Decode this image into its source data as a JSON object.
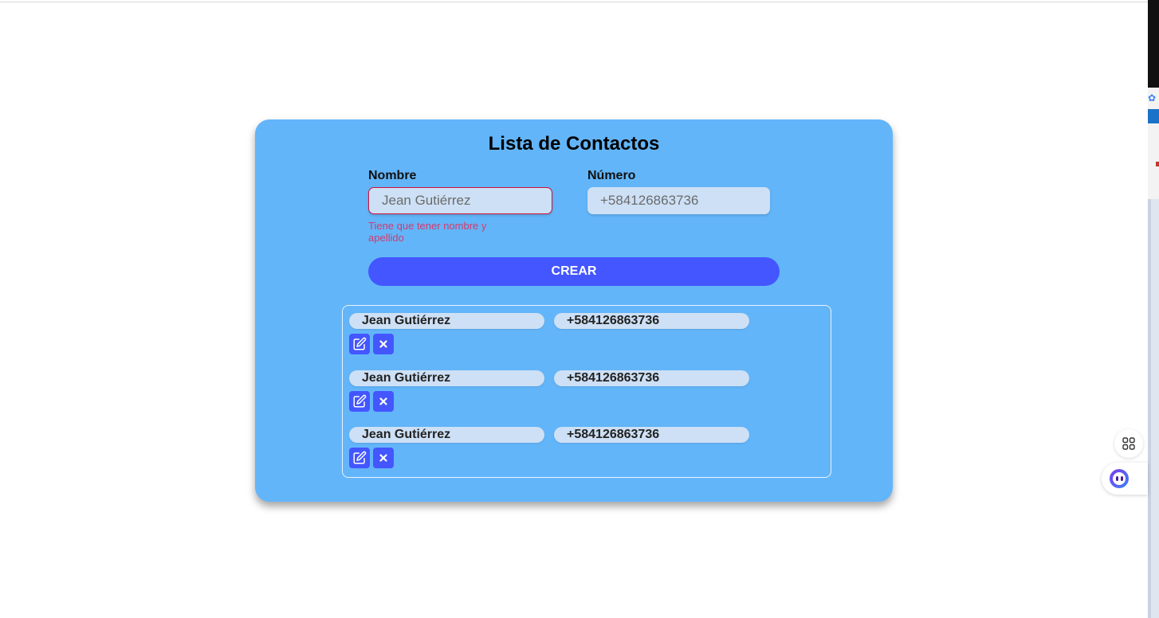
{
  "app": {
    "title": "Lista de Contactos"
  },
  "form": {
    "name_label": "Nombre",
    "name_placeholder": "Jean Gutiérrez",
    "name_error": "Tiene que tener nombre y apellido",
    "number_label": "Número",
    "number_placeholder": "+584126863736",
    "create_label": "CREAR"
  },
  "contacts": [
    {
      "name": "Jean Gutiérrez",
      "number": "+584126863736"
    },
    {
      "name": "Jean Gutiérrez",
      "number": "+584126863736"
    },
    {
      "name": "Jean Gutiérrez",
      "number": "+584126863736"
    }
  ],
  "icons": {
    "edit": "edit-icon",
    "delete": "close-icon",
    "apps": "apps-grid-icon",
    "assistant": "assistant-bot-icon"
  },
  "colors": {
    "card": "#63b5f9",
    "button": "#4356ff",
    "input": "#cde0f5",
    "error": "#d33a6c"
  }
}
